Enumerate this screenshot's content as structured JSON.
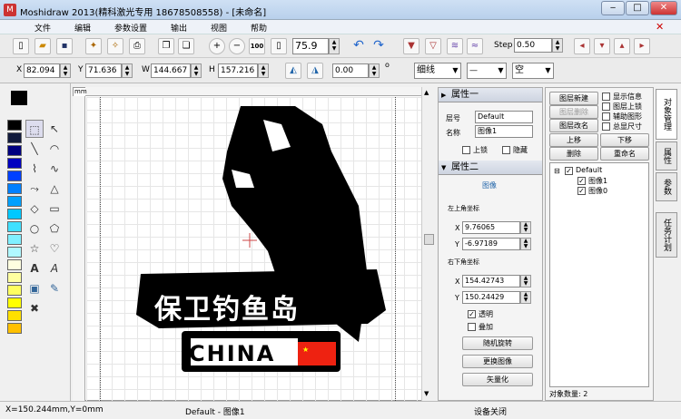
{
  "window": {
    "title": "Moshidraw 2013(精科激光专用 18678508558) - [未命名]"
  },
  "menu": [
    "文件",
    "编辑",
    "参数设置",
    "输出",
    "视图",
    "帮助"
  ],
  "toolbar": {
    "zoom_value": "75.9",
    "zoom_100": "100",
    "step_label": "Step",
    "step_value": "0.50"
  },
  "coords": {
    "x_label": "X",
    "x_value": "82.094",
    "y_label": "Y",
    "y_value": "71.636",
    "w_label": "W",
    "w_value": "144.667",
    "h_label": "H",
    "h_value": "157.216",
    "angle_value": "0.00",
    "degree_symbol": "o",
    "line_style": "细线",
    "line_pattern": "—",
    "fill_style": "空"
  },
  "ruler": {
    "unit": "mm"
  },
  "artwork": {
    "slogan": "保卫钓鱼岛",
    "china": "CHINA"
  },
  "properties": {
    "section1_title": "属性一",
    "layer_label": "层号",
    "layer_value": "Default",
    "name_label": "名称",
    "name_value": "图像1",
    "lock_label": "上锁",
    "hide_label": "隐藏",
    "section2_title": "属性二",
    "image_label": "图像",
    "top_left_label": "左上角坐标",
    "tl_x_label": "X",
    "tl_x": "9.76065",
    "tl_y_label": "Y",
    "tl_y": "-6.97189",
    "bottom_right_label": "右下角坐标",
    "br_x_label": "X",
    "br_x": "154.42743",
    "br_y_label": "Y",
    "br_y": "150.24429",
    "transparent_label": "透明",
    "overlay_label": "叠加",
    "random_rotate": "随机旋转",
    "replace_image": "更换图像",
    "vectorize": "矢量化"
  },
  "layers_panel": {
    "new_layer": "图层新建",
    "delete_layer": "图层删除",
    "rename_layer": "图层改名",
    "show_info": "显示信息",
    "lock_layer": "图层上锁",
    "aux_graphics": "辅助图形",
    "always_size": "总显尺寸",
    "move_up": "上移",
    "move_down": "下移",
    "delete": "删除",
    "rename": "重命名",
    "tree": {
      "root": "Default",
      "children": [
        "图像1",
        "图像0"
      ]
    },
    "object_count": "对象数量: 2"
  },
  "vertical_tabs": [
    "对象管理",
    "属性",
    "参数",
    "任务计划"
  ],
  "status": {
    "coords": "X=150.244mm,Y=0mm",
    "layer": "Default - 图像1",
    "device": "设备关闭"
  },
  "colors": {
    "palette": [
      "#000000",
      "#111a3c",
      "#000080",
      "#0000c0",
      "#0040ff",
      "#0080ff",
      "#00a0ff",
      "#00c8ff",
      "#40e0ff",
      "#80f0ff",
      "#b0f8ff",
      "#ffffe0",
      "#ffffa0",
      "#ffff60",
      "#ffff00",
      "#ffe000",
      "#ffc000"
    ]
  }
}
